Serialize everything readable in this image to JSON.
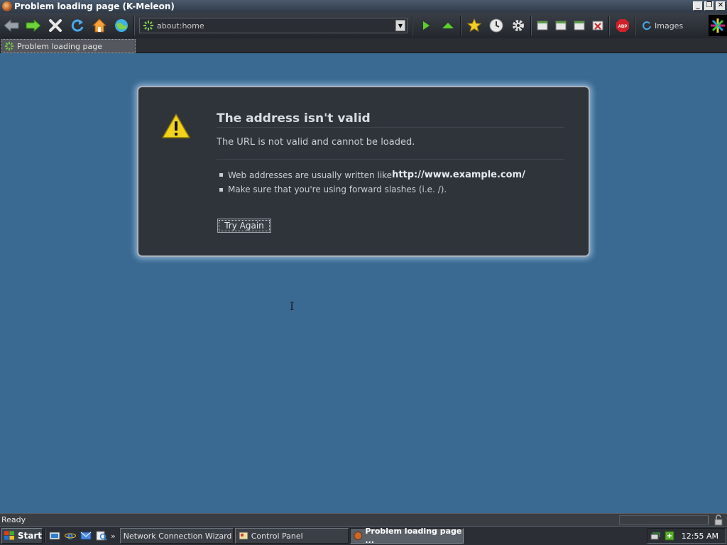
{
  "window": {
    "title": "Problem loading page (K-Meleon)",
    "controls": [
      "minimize",
      "restore",
      "close"
    ]
  },
  "toolbar": {
    "nav_icons": [
      "back-icon",
      "forward-icon",
      "stop-icon",
      "reload-icon",
      "home-icon",
      "globe-icon"
    ],
    "url": "about:home",
    "go_icons": [
      "go-icon",
      "up-icon"
    ],
    "tool_icons": [
      "bookmark-star-icon",
      "history-clock-icon",
      "settings-gear-icon"
    ],
    "window_icons": [
      "window-icon",
      "window-icon",
      "window-icon",
      "close-window-icon"
    ],
    "adblock_label": "ABP",
    "images_label": "Images"
  },
  "tab": {
    "label": "Problem loading page"
  },
  "error": {
    "title": "The address isn't valid",
    "description": "The URL is not valid and cannot be loaded.",
    "item1_prefix": "Web addresses are usually written like ",
    "item1_bold": "http://www.example.com/",
    "item2": "Make sure that you're using forward slashes (i.e. /).",
    "button": "Try Again"
  },
  "status": {
    "text": "Ready"
  },
  "taskbar": {
    "start_label": "Start",
    "quick_launch": [
      "show-desktop-icon",
      "ie-icon",
      "outlook-icon",
      "search-icon"
    ],
    "more_label": "»",
    "tasks": [
      {
        "label": "Network Connection Wizard"
      },
      {
        "label": "Control Panel"
      },
      {
        "label": "Problem loading page ..."
      }
    ],
    "clock": "12:55 AM"
  },
  "colors": {
    "content_bg": "#3a6a92",
    "dialog_bg": "#2f343b",
    "dialog_border": "#aab3bc",
    "warning_yellow": "#f2d21a"
  }
}
